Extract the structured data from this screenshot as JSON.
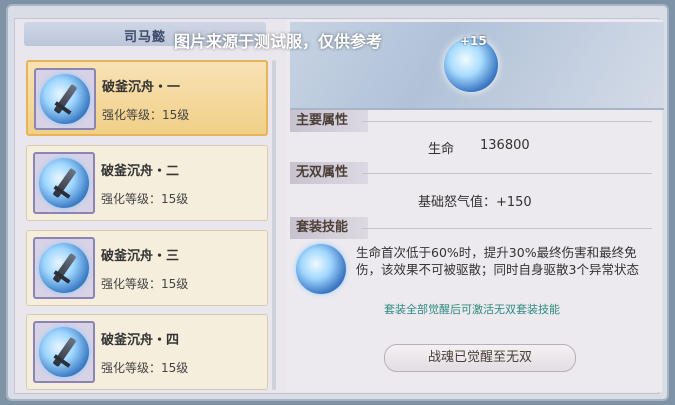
{
  "header": {
    "name": "司马懿",
    "watermark": "图片来源于测试服，仅供参考"
  },
  "banner": {
    "enhance": "+15"
  },
  "cards": [
    {
      "title": "破釜沉舟・一",
      "level": "强化等级：15级"
    },
    {
      "title": "破釜沉舟・二",
      "level": "强化等级：15级"
    },
    {
      "title": "破釜沉舟・三",
      "level": "强化等级：15级"
    },
    {
      "title": "破釜沉舟・四",
      "level": "强化等级：15级"
    }
  ],
  "sections": {
    "main_attr": "主要属性",
    "wushuang_attr": "无双属性",
    "set_skill": "套装技能"
  },
  "main_stat": {
    "name": "生命",
    "value": "136800"
  },
  "wushuang_stat": {
    "text": "基础怒气值：+150"
  },
  "skill": {
    "description": "生命首次低于60%时，提升30%最终伤害和最终免伤，该效果不可被驱散；同时自身驱散3个异常状态",
    "note": "套装全部觉醒后可激活无双套装技能"
  },
  "awaken_button": "战魂已觉醒至无双"
}
